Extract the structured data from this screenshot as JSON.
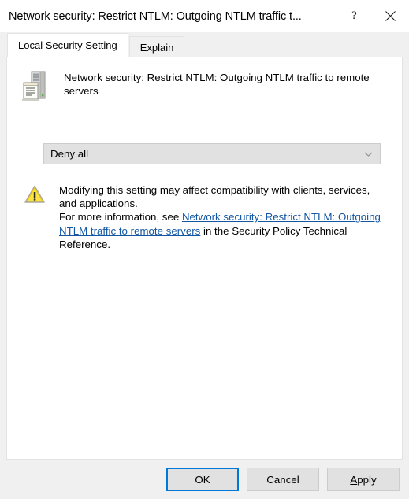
{
  "window": {
    "title": "Network security: Restrict NTLM: Outgoing NTLM traffic t...",
    "help_label": "?",
    "close_label": "×"
  },
  "tabs": [
    {
      "label": "Local Security Setting",
      "active": true
    },
    {
      "label": "Explain",
      "active": false
    }
  ],
  "setting": {
    "icon": "server-policy-icon",
    "title": "Network security: Restrict NTLM: Outgoing NTLM traffic to remote servers",
    "dropdown": {
      "value": "Deny all",
      "arrow_icon": "chevron-down-icon"
    }
  },
  "warning": {
    "icon": "warning-triangle-icon",
    "line1": "Modifying this setting may affect compatibility with clients, services,",
    "line2": "and applications.",
    "intro": "For more information, see ",
    "link_text": "Network security: Restrict NTLM: Outgoing NTLM traffic to remote servers",
    "outro": " in the Security Policy Technical Reference."
  },
  "buttons": {
    "ok": "OK",
    "cancel": "Cancel",
    "apply_accel": "A",
    "apply_rest": "pply"
  },
  "colors": {
    "accent": "#0078d7",
    "link": "#1356a2",
    "warning": "#f5c518",
    "dialog_bg": "#f0f0f0",
    "panel_bg": "#ffffff"
  }
}
